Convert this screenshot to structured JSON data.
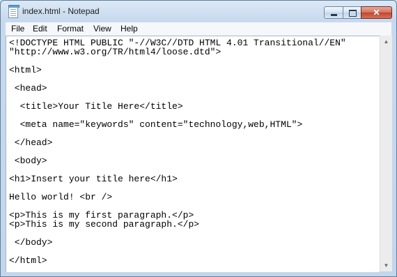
{
  "window": {
    "title": "index.html - Notepad"
  },
  "menu": [
    "File",
    "Edit",
    "Format",
    "View",
    "Help"
  ],
  "editor": {
    "lines": [
      "<!DOCTYPE HTML PUBLIC \"-//W3C//DTD HTML 4.01 Transitional//EN\"",
      "\"http://www.w3.org/TR/html4/loose.dtd\">",
      "<html>",
      " <head>",
      "  <title>Your Title Here</title>",
      "  <meta name=\"keywords\" content=\"technology,web,HTML\">",
      " </head>",
      " <body>",
      "<h1>Insert your title here</h1>",
      "Hello world! <br />",
      "<p>This is my first paragraph.</p>",
      "<p>This is my second paragraph.</p>",
      " </body>",
      "</html>"
    ]
  },
  "icons": {
    "app": "notepad-icon",
    "minimize": "minimize-icon",
    "maximize": "maximize-icon",
    "close": "close-icon",
    "scroll_up": "scroll-up-arrow-icon",
    "scroll_down": "scroll-down-arrow-icon"
  },
  "colors": {
    "close_button": "#c7472e",
    "editor_background": "#ffffff"
  }
}
